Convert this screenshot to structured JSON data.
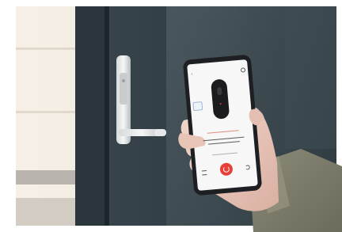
{
  "scene": {
    "description_free": true
  },
  "phone_app": {
    "status_time": "",
    "status_battery": ""
  },
  "colors": {
    "accent": "#e6403a",
    "door": "#2e3a40",
    "phone_body": "#1e1f22",
    "coat": "#7b7a6a"
  },
  "icons": [
    "settings-icon",
    "back-icon",
    "menu-icon",
    "refresh-icon"
  ]
}
